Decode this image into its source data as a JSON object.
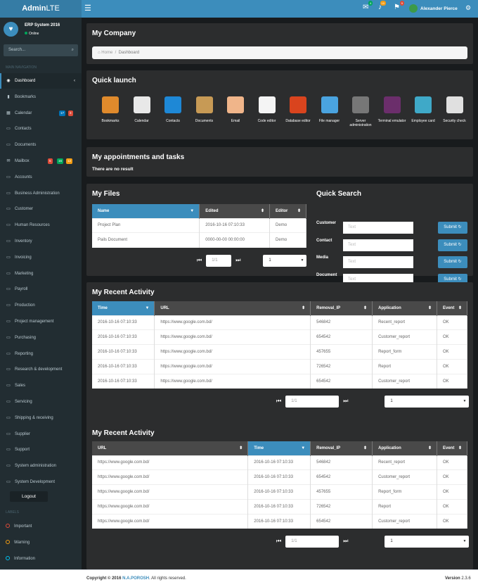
{
  "brand": {
    "bold": "Admin",
    "light": "LTE"
  },
  "topbar": {
    "mail_count": "4",
    "bell_count": "10",
    "flag_count": "9",
    "user_name": "Alexander Pierce",
    "colors": {
      "mail": "#00a65a",
      "bell": "#f39c12",
      "flag": "#dd4b39"
    }
  },
  "user_panel": {
    "name": "ERP System 2016",
    "status": "Online"
  },
  "search": {
    "placeholder": "Search..."
  },
  "nav": {
    "header": "MAIN NAVIGATION",
    "items": [
      {
        "label": "Dashboard",
        "icon": "dashboard-icon"
      },
      {
        "label": "Bookmarks",
        "icon": "bookmark-icon"
      },
      {
        "label": "Calendar",
        "icon": "calendar-icon",
        "badges": [
          "17",
          "3"
        ]
      },
      {
        "label": "Contacts",
        "icon": "folder-icon"
      },
      {
        "label": "Documents",
        "icon": "folder-icon"
      },
      {
        "label": "Mailbox",
        "icon": "envelope-icon",
        "badges": [
          "5",
          "16",
          "12"
        ]
      },
      {
        "label": "Accounts",
        "icon": "folder-icon"
      },
      {
        "label": "Business Administration",
        "icon": "folder-icon"
      },
      {
        "label": "Customer",
        "icon": "folder-icon"
      },
      {
        "label": "Human Resources",
        "icon": "folder-icon"
      },
      {
        "label": "Inventory",
        "icon": "folder-icon"
      },
      {
        "label": "Invoicing",
        "icon": "folder-icon"
      },
      {
        "label": "Marketing",
        "icon": "folder-icon"
      },
      {
        "label": "Payroll",
        "icon": "folder-icon"
      },
      {
        "label": "Production",
        "icon": "folder-icon"
      },
      {
        "label": "Project management",
        "icon": "folder-icon"
      },
      {
        "label": "Purchasing",
        "icon": "folder-icon"
      },
      {
        "label": "Reporting",
        "icon": "folder-icon"
      },
      {
        "label": "Research & development",
        "icon": "folder-icon"
      },
      {
        "label": "Sales",
        "icon": "folder-icon"
      },
      {
        "label": "Servicing",
        "icon": "folder-icon"
      },
      {
        "label": "Shipping & receiving",
        "icon": "folder-icon"
      },
      {
        "label": "Supplier",
        "icon": "folder-icon"
      },
      {
        "label": "Support",
        "icon": "folder-icon"
      },
      {
        "label": "System administration",
        "icon": "folder-icon"
      },
      {
        "label": "System Development",
        "icon": "folder-icon"
      }
    ],
    "logout": "Logout",
    "labels_header": "LABELS",
    "labels": [
      {
        "label": "Important",
        "color": "#dd4b39"
      },
      {
        "label": "Warning",
        "color": "#f39c12"
      },
      {
        "label": "Information",
        "color": "#00c0ef"
      }
    ]
  },
  "company": {
    "title": "My Company",
    "breadcrumb": {
      "home": "Home",
      "sep": "/",
      "current": "Dashboard"
    }
  },
  "quick_launch": {
    "title": "Quick launch",
    "items": [
      {
        "label": "Bookmarks",
        "icon": "bookmarks-icon",
        "color": "#e08a2c"
      },
      {
        "label": "Calendar",
        "icon": "calendar-icon",
        "color": "#e8e8e8"
      },
      {
        "label": "Contacts",
        "icon": "contacts-icon",
        "color": "#1e88d6"
      },
      {
        "label": "Documents",
        "icon": "documents-icon",
        "color": "#c79a55"
      },
      {
        "label": "Email",
        "icon": "email-icon",
        "color": "#f0b58a"
      },
      {
        "label": "Code editor",
        "icon": "code-editor-icon",
        "color": "#f4f4f4"
      },
      {
        "label": "Database editor",
        "icon": "database-icon",
        "color": "#d9441e"
      },
      {
        "label": "File manager",
        "icon": "file-manager-icon",
        "color": "#4aa3df"
      },
      {
        "label": "Server administration",
        "icon": "server-icon",
        "color": "#777777"
      },
      {
        "label": "Terminal emulator",
        "icon": "terminal-icon",
        "color": "#6b2e6b"
      },
      {
        "label": "Employee card",
        "icon": "employee-card-icon",
        "color": "#3fa9c8"
      },
      {
        "label": "Security check",
        "icon": "security-icon",
        "color": "#e0e0e0"
      }
    ]
  },
  "appointments": {
    "title": "My appointments and tasks",
    "empty": "There are no result"
  },
  "files": {
    "title": "My Files",
    "columns": [
      "Name",
      "Edited",
      "Editor"
    ],
    "rows": [
      [
        "Project Plan",
        "2016-10-16 07:10:33",
        "Demo"
      ],
      [
        "Pails Document",
        "0000-00-00 00:00:00",
        "Demo"
      ]
    ],
    "page": "1/1",
    "page_size": "1"
  },
  "quick_search": {
    "title": "Quick Search",
    "fields": [
      {
        "label": "Customer",
        "placeholder": "Text"
      },
      {
        "label": "Contact",
        "placeholder": "Text"
      },
      {
        "label": "Media",
        "placeholder": "Text"
      },
      {
        "label": "Document",
        "placeholder": "Text"
      }
    ],
    "submit": "Submit"
  },
  "activity1": {
    "title": "My Recent Activity",
    "columns": [
      "Time",
      "URL",
      "Removal_IP",
      "Application",
      "Event"
    ],
    "rows": [
      [
        "2016-10-16 07:10:33",
        "https://www.google.com.bd/",
        "546842",
        "Recent_report",
        "OK"
      ],
      [
        "2016-10-16 07:10:33",
        "https://www.google.com.bd/",
        "654542",
        "Customer_report",
        "OK"
      ],
      [
        "2016-10-16 07:10:33",
        "https://www.google.com.bd/",
        "457655",
        "Report_form",
        "OK"
      ],
      [
        "2016-10-16 07:10:33",
        "https://www.google.com.bd/",
        "726542",
        "Report",
        "OK"
      ],
      [
        "2016-10-16 07:10:33",
        "https://www.google.com.bd/",
        "654542",
        "Customer_report",
        "OK"
      ]
    ],
    "page": "1/1",
    "page_size": "1"
  },
  "activity2": {
    "title": "My Recent Activity",
    "columns": [
      "URL",
      "Time",
      "Removal_IP",
      "Application",
      "Event"
    ],
    "rows": [
      [
        "https://www.google.com.bd/",
        "2016-10-16 07:10:33",
        "546842",
        "Recent_report",
        "OK"
      ],
      [
        "https://www.google.com.bd/",
        "2016-10-16 07:10:33",
        "654542",
        "Customer_report",
        "OK"
      ],
      [
        "https://www.google.com.bd/",
        "2016-10-16 07:10:33",
        "457655",
        "Report_form",
        "OK"
      ],
      [
        "https://www.google.com.bd/",
        "2016-10-16 07:10:33",
        "726542",
        "Report",
        "OK"
      ],
      [
        "https://www.google.com.bd/",
        "2016-10-16 07:10:33",
        "654542",
        "Customer_report",
        "OK"
      ]
    ],
    "page": "1/1",
    "page_size": "1"
  },
  "footer": {
    "copyright_prefix": "Copyright © 2016",
    "author": "N.A.POROSH",
    "rights": ". All rights reserved.",
    "version_label": "Version",
    "version": "2.3.6"
  }
}
